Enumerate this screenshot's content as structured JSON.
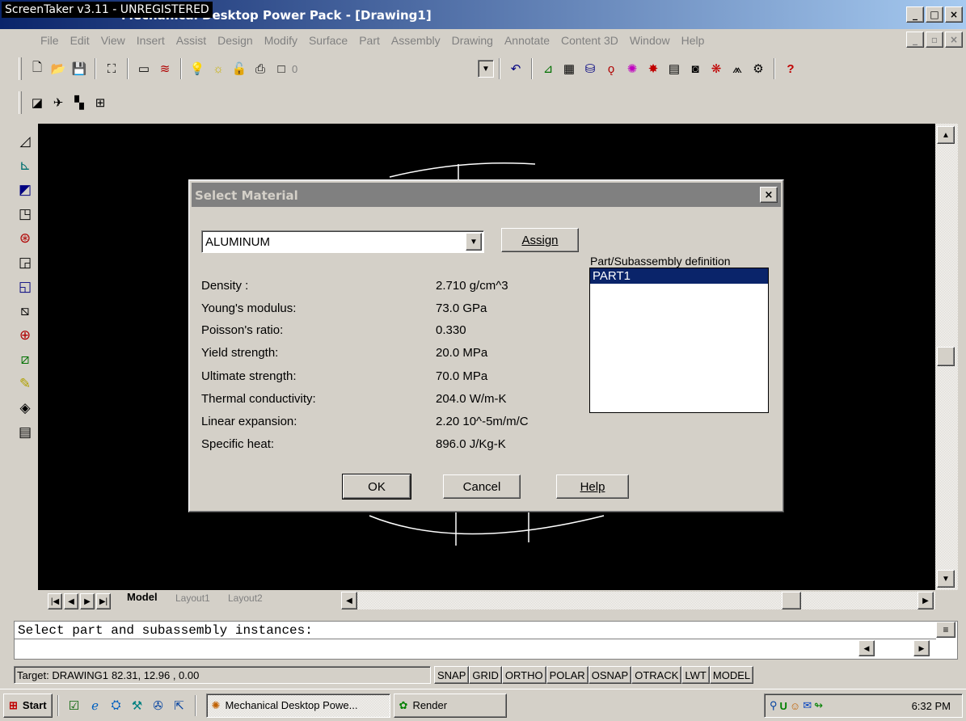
{
  "window": {
    "watermark": "ScreenTaker v3.11 - UNREGISTERED",
    "title": "Mechanical Desktop Power Pack - [Drawing1]",
    "min": "_",
    "max": "□",
    "close": "×",
    "doc_min": "_",
    "doc_restore": "▫",
    "doc_close": "×"
  },
  "menu": [
    "File",
    "Edit",
    "View",
    "Insert",
    "Assist",
    "Design",
    "Modify",
    "Surface",
    "Part",
    "Assembly",
    "Drawing",
    "Annotate",
    "Content 3D",
    "Window",
    "Help"
  ],
  "toolbar": {
    "layer_value": "0"
  },
  "tabs": {
    "model": "Model",
    "layout1": "Layout1",
    "layout2": "Layout2"
  },
  "command": {
    "line1": "Select part and subassembly instances:",
    "line2": ""
  },
  "status": {
    "target": "Target: DRAWING1",
    "coords": "82.31, 12.96 , 0.00",
    "toggles": [
      "SNAP",
      "GRID",
      "ORTHO",
      "POLAR",
      "OSNAP",
      "OTRACK",
      "LWT",
      "MODEL"
    ]
  },
  "taskbar": {
    "start": "Start",
    "tasks": [
      "Mechanical Desktop Powe...",
      "Render"
    ],
    "clock": "6:32 PM"
  },
  "dialog": {
    "title": "Select Material",
    "close": "×",
    "material": "ALUMINUM",
    "assign_label": "Assign",
    "properties": [
      {
        "label": "Density :",
        "value": "2.710 g/cm^3"
      },
      {
        "label": "Young's modulus:",
        "value": "73.0 GPa"
      },
      {
        "label": "Poisson's ratio:",
        "value": "0.330"
      },
      {
        "label": "Yield strength:",
        "value": "20.0 MPa"
      },
      {
        "label": "Ultimate strength:",
        "value": "70.0 MPa"
      },
      {
        "label": "Thermal conductivity:",
        "value": "204.0 W/m-K"
      },
      {
        "label": "Linear expansion:",
        "value": "2.20 10^-5m/m/C"
      },
      {
        "label": "Specific heat:",
        "value": "896.0 J/Kg-K"
      }
    ],
    "list_label": "Part/Subassembly definition",
    "list_items": [
      "PART1"
    ],
    "ok": "OK",
    "cancel": "Cancel",
    "help": "Help"
  },
  "colors": {
    "title_active": "#0a246a",
    "dialog_title_inactive": "#808080",
    "canvas": "#000000",
    "selection": "#0a246a"
  }
}
